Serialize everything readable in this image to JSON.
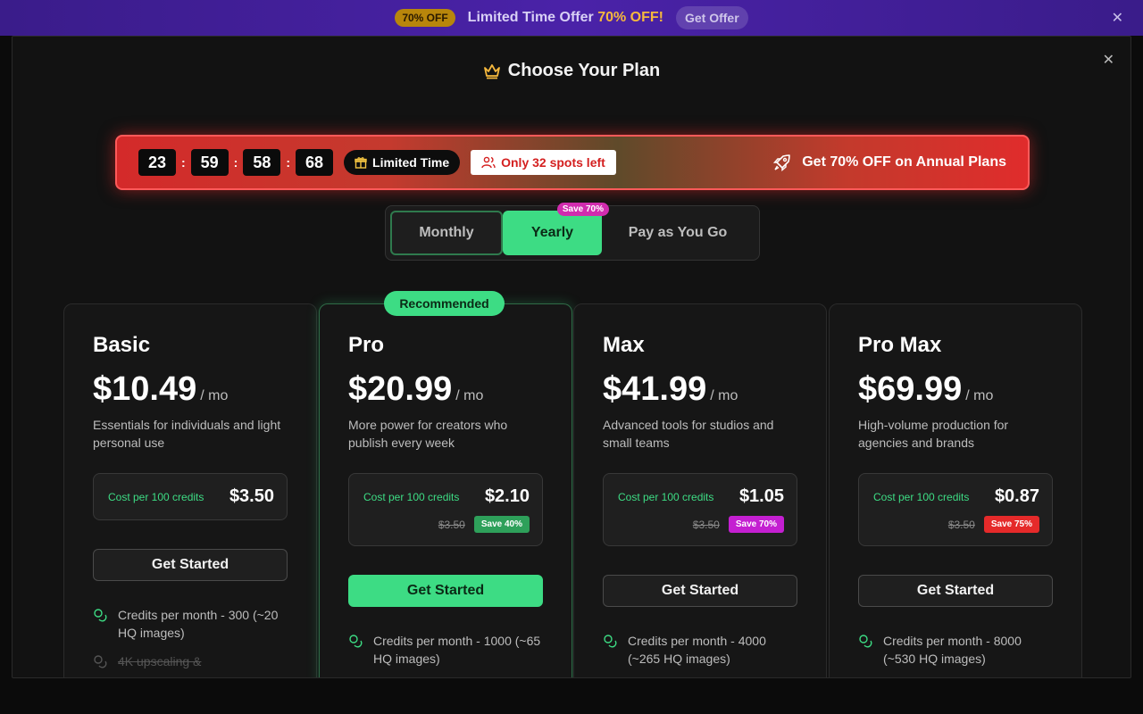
{
  "banner": {
    "badge": "70% OFF",
    "text": "Limited Time Offer",
    "highlight": "70% OFF!",
    "button": "Get Offer"
  },
  "modal": {
    "title": "Choose Your Plan"
  },
  "promo": {
    "timer": [
      "23",
      "59",
      "58",
      "68"
    ],
    "limited": "Limited Time",
    "spots": "Only 32 spots left",
    "annual": "Get 70% OFF on Annual Plans"
  },
  "billing": {
    "options": [
      "Monthly",
      "Yearly",
      "Pay as You Go"
    ],
    "selected": "Yearly",
    "badge": "Save 70%"
  },
  "recommended": "Recommended",
  "plans": [
    {
      "name": "Basic",
      "price": "$10.49",
      "period": "/ mo",
      "desc": "Essentials for individuals and light personal use",
      "cost_label": "Cost per 100 credits",
      "cost": "$3.50",
      "old": "",
      "save": "",
      "button": "Get Started",
      "features": [
        "Credits per month - 300 (~20 HQ images)",
        "4K upscaling &"
      ]
    },
    {
      "name": "Pro",
      "price": "$20.99",
      "period": "/ mo",
      "desc": "More power for creators who publish every week",
      "cost_label": "Cost per 100 credits",
      "cost": "$2.10",
      "old": "$3.50",
      "save": "Save 40%",
      "button": "Get Started",
      "features": [
        "Credits per month - 1000 (~65 HQ images)"
      ]
    },
    {
      "name": "Max",
      "price": "$41.99",
      "period": "/ mo",
      "desc": "Advanced tools for studios and small teams",
      "cost_label": "Cost per 100 credits",
      "cost": "$1.05",
      "old": "$3.50",
      "save": "Save 70%",
      "button": "Get Started",
      "features": [
        "Credits per month - 4000 (~265 HQ images)"
      ]
    },
    {
      "name": "Pro Max",
      "price": "$69.99",
      "period": "/ mo",
      "desc": "High-volume production for agencies and brands",
      "cost_label": "Cost per 100 credits",
      "cost": "$0.87",
      "old": "$3.50",
      "save": "Save 75%",
      "button": "Get Started",
      "features": [
        "Credits per month - 8000 (~530 HQ images)"
      ]
    }
  ],
  "colors": {
    "accent": "#3ddc84",
    "save40": "#2ea05a",
    "save70": "#c41fd1",
    "save75": "#e52a2a",
    "promo_red": "#d42a2a"
  }
}
